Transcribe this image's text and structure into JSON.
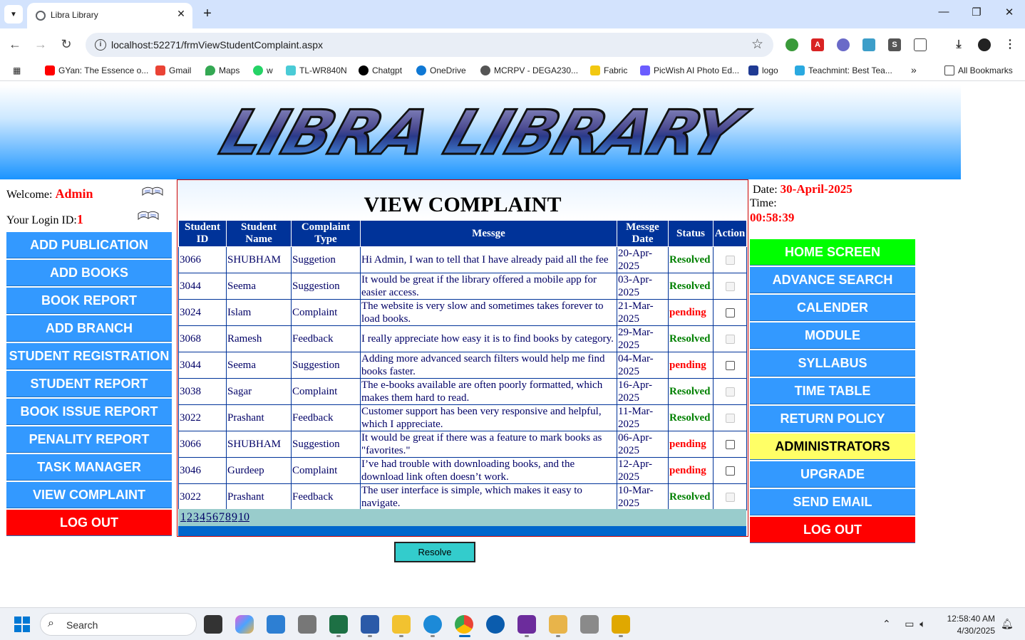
{
  "browser": {
    "tab_title": "Libra Library",
    "tab_close": "✕",
    "new_tab": "+",
    "url": "localhost:52271/frmViewStudentComplaint.aspx",
    "bookmarks": [
      {
        "label": "GYan: The Essence o...",
        "icon": "youtube-icon",
        "color": "#ff0000"
      },
      {
        "label": "Gmail",
        "icon": "gmail-icon",
        "color": "#ea4335"
      },
      {
        "label": "Maps",
        "icon": "maps-icon",
        "color": "#34a853"
      },
      {
        "label": "w",
        "icon": "whatsapp-icon",
        "color": "#25d366"
      },
      {
        "label": "TL-WR840N",
        "icon": "tplink-icon",
        "color": "#4acbd6"
      },
      {
        "label": "Chatgpt",
        "icon": "chatgpt-icon",
        "color": "#000000"
      },
      {
        "label": "OneDrive",
        "icon": "onedrive-icon",
        "color": "#0f78d4"
      },
      {
        "label": "MCRPV - DEGA230...",
        "icon": "globe-icon",
        "color": "#555555"
      },
      {
        "label": "Fabric",
        "icon": "fabric-icon",
        "color": "#f2c811"
      },
      {
        "label": "PicWish AI Photo Ed...",
        "icon": "picwish-icon",
        "color": "#6b5cff"
      },
      {
        "label": "logo",
        "icon": "gh-icon",
        "color": "#1f3a93"
      },
      {
        "label": "Teachmint: Best Tea...",
        "icon": "teachmint-icon",
        "color": "#2aa9e0"
      }
    ],
    "more_bookmarks": "»",
    "all_bookmarks": "All Bookmarks"
  },
  "banner": {
    "logo_text": "LIBRA LIBRARY"
  },
  "left": {
    "welcome_label": "Welcome: ",
    "welcome_name": "Admin",
    "login_label": "Your Login ID:",
    "login_id": "1",
    "menu": [
      "ADD PUBLICATION",
      "ADD BOOKS",
      "BOOK REPORT",
      "ADD BRANCH",
      "STUDENT REGISTRATION",
      "STUDENT REPORT",
      "BOOK ISSUE REPORT",
      "PENALITY REPORT",
      "TASK MANAGER",
      "VIEW COMPLAINT"
    ],
    "logout": "LOG OUT"
  },
  "main": {
    "title": "VIEW COMPLAINT",
    "columns": [
      "Student ID",
      "Student Name",
      "Complaint Type",
      "Messge",
      "Messge Date",
      "Status",
      "Action"
    ],
    "rows": [
      {
        "id": "3066",
        "name": "SHUBHAM",
        "type": "Suggetion",
        "message": "Hi Admin, I wan to tell that I have already paid all the fee",
        "date": "20-Apr-2025",
        "status": "Resolved",
        "checkbox_enabled": false
      },
      {
        "id": "3044",
        "name": "Seema",
        "type": "Suggestion",
        "message": "It would be great if the library offered a mobile app for easier access.",
        "date": "03-Apr-2025",
        "status": "Resolved",
        "checkbox_enabled": false
      },
      {
        "id": "3024",
        "name": "Islam",
        "type": "Complaint",
        "message": "The website is very slow and sometimes takes forever to load books.",
        "date": "21-Mar-2025",
        "status": "pending",
        "checkbox_enabled": true
      },
      {
        "id": "3068",
        "name": "Ramesh",
        "type": "Feedback",
        "message": "I really appreciate how easy it is to find books by category.",
        "date": "29-Mar-2025",
        "status": "Resolved",
        "checkbox_enabled": false
      },
      {
        "id": "3044",
        "name": "Seema",
        "type": "Suggestion",
        "message": "Adding more advanced search filters would help me find books faster.",
        "date": "04-Mar-2025",
        "status": "pending",
        "checkbox_enabled": true
      },
      {
        "id": "3038",
        "name": "Sagar",
        "type": "Complaint",
        "message": "The e-books available are often poorly formatted, which makes them hard to read.",
        "date": "16-Apr-2025",
        "status": "Resolved",
        "checkbox_enabled": false
      },
      {
        "id": "3022",
        "name": "Prashant",
        "type": "Feedback",
        "message": "Customer support has been very responsive and helpful, which I appreciate.",
        "date": "11-Mar-2025",
        "status": "Resolved",
        "checkbox_enabled": false
      },
      {
        "id": "3066",
        "name": "SHUBHAM",
        "type": "Suggestion",
        "message": "It would be great if there was a feature to mark books as \"favorites.\"",
        "date": "06-Apr-2025",
        "status": "pending",
        "checkbox_enabled": true
      },
      {
        "id": "3046",
        "name": "Gurdeep",
        "type": "Complaint",
        "message": "I’ve had trouble with downloading books, and the download link often doesn’t work.",
        "date": "12-Apr-2025",
        "status": "pending",
        "checkbox_enabled": true
      },
      {
        "id": "3022",
        "name": "Prashant",
        "type": "Feedback",
        "message": "The user interface is simple, which makes it easy to navigate.",
        "date": "10-Mar-2025",
        "status": "Resolved",
        "checkbox_enabled": false
      }
    ],
    "pages": [
      "1",
      "2",
      "3",
      "4",
      "5",
      "6",
      "7",
      "8",
      "9",
      "10"
    ],
    "resolve_button": "Resolve",
    "status_colors": {
      "Resolved": "#008000",
      "pending": "#ff0000"
    }
  },
  "right": {
    "date_label": "Date: ",
    "date_value": "30-April-2025",
    "time_label": "Time:",
    "time_value": "00:58:39",
    "menu": [
      {
        "label": "HOME SCREEN",
        "style": "home"
      },
      {
        "label": "ADVANCE SEARCH",
        "style": ""
      },
      {
        "label": "CALENDER",
        "style": ""
      },
      {
        "label": "MODULE",
        "style": ""
      },
      {
        "label": "SYLLABUS",
        "style": ""
      },
      {
        "label": "TIME TABLE",
        "style": ""
      },
      {
        "label": "RETURN POLICY",
        "style": ""
      },
      {
        "label": "ADMINISTRATORS",
        "style": "admin"
      },
      {
        "label": "UPGRADE",
        "style": ""
      },
      {
        "label": "SEND EMAIL",
        "style": ""
      },
      {
        "label": "LOG OUT",
        "style": "logout"
      }
    ]
  },
  "taskbar": {
    "search_placeholder": "Search",
    "clock_time": "12:58:40 AM",
    "clock_date": "4/30/2025"
  }
}
